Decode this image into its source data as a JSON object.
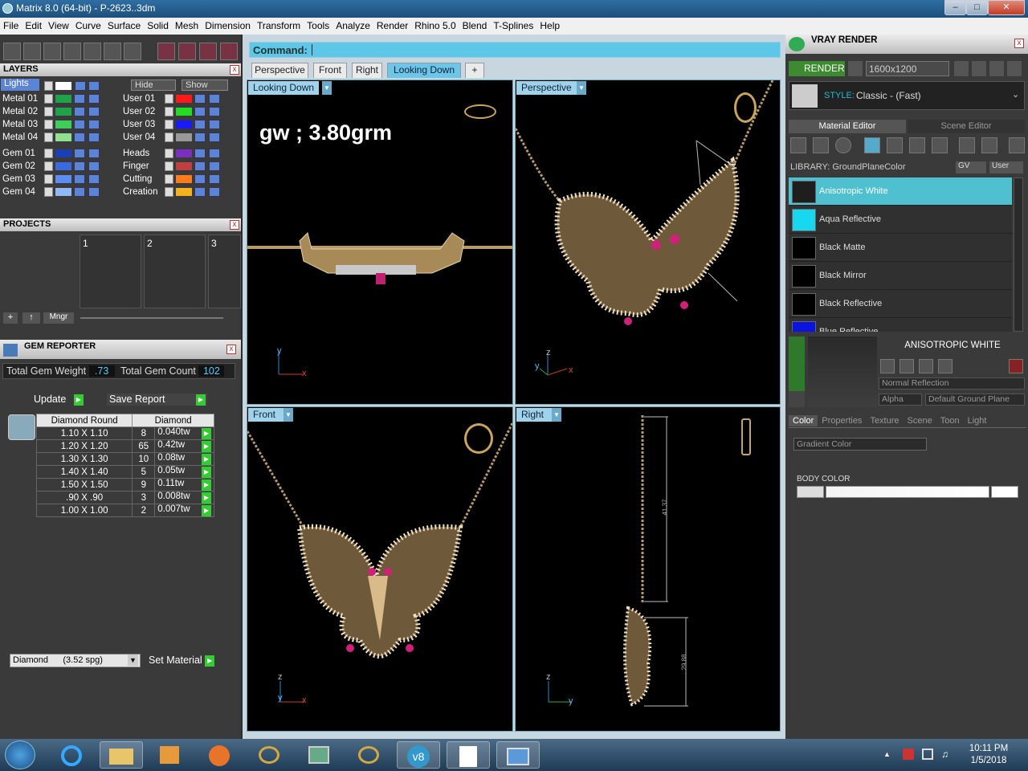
{
  "window": {
    "title": "Matrix 8.0 (64-bit) - P-2623..3dm"
  },
  "menu": [
    "File",
    "Edit",
    "View",
    "Curve",
    "Surface",
    "Solid",
    "Mesh",
    "Dimension",
    "Transform",
    "Tools",
    "Analyze",
    "Render",
    "Rhino 5.0",
    "Blend",
    "T-Splines",
    "Help"
  ],
  "layers": {
    "title": "LAYERS",
    "lights_label": "Lights",
    "hide_label": "Hide",
    "show_label": "Show",
    "left": [
      {
        "name": "Metal 01",
        "color": "#1fa34a"
      },
      {
        "name": "Metal 02",
        "color": "#1fa34a"
      },
      {
        "name": "Metal 03",
        "color": "#3ccf5a"
      },
      {
        "name": "Metal 04",
        "color": "#8fe08f"
      },
      {
        "name": "Gem 01",
        "color": "#1a3fb8"
      },
      {
        "name": "Gem 02",
        "color": "#3a6ae0"
      },
      {
        "name": "Gem 03",
        "color": "#5b8ef0"
      },
      {
        "name": "Gem 04",
        "color": "#8fb8f5"
      }
    ],
    "right": [
      {
        "name": "User 01",
        "color": "#ff1a1a"
      },
      {
        "name": "User 02",
        "color": "#22dd22"
      },
      {
        "name": "User 03",
        "color": "#1a1aff"
      },
      {
        "name": "User 04",
        "color": "#999999"
      },
      {
        "name": "Heads",
        "color": "#7a2fc0"
      },
      {
        "name": "Finger",
        "color": "#c04040"
      },
      {
        "name": "Cutting",
        "color": "#ff7a1a"
      },
      {
        "name": "Creation",
        "color": "#f5b21a"
      }
    ]
  },
  "projects": {
    "title": "PROJECTS",
    "slots": [
      "1",
      "2",
      "3"
    ],
    "mngr_label": "Mngr"
  },
  "gem_reporter": {
    "title": "GEM REPORTER",
    "weight_label": "Total Gem Weight",
    "weight_value": ".73",
    "count_label": "Total Gem Count",
    "count_value": "102",
    "update_label": "Update",
    "save_label": "Save Report",
    "col1": "Diamond Round",
    "col2": "Diamond",
    "rows": [
      {
        "size": "1.10 X 1.10",
        "count": "8",
        "tw": "0.040tw"
      },
      {
        "size": "1.20 X 1.20",
        "count": "65",
        "tw": "0.42tw"
      },
      {
        "size": "1.30 X 1.30",
        "count": "10",
        "tw": "0.08tw"
      },
      {
        "size": "1.40 X 1.40",
        "count": "5",
        "tw": "0.05tw"
      },
      {
        "size": "1.50 X 1.50",
        "count": "9",
        "tw": "0.11tw"
      },
      {
        "size": ".90 X .90",
        "count": "3",
        "tw": "0.008tw"
      },
      {
        "size": "1.00 X 1.00",
        "count": "2",
        "tw": "0.007tw"
      }
    ],
    "material_select": "Diamond      (3.52 spg)",
    "set_material_label": "Set Material"
  },
  "command": {
    "label": "Command:"
  },
  "view_tabs": [
    "Perspective",
    "Front",
    "Right",
    "Looking Down"
  ],
  "viewports": {
    "top_left": {
      "label": "Looking Down",
      "annotation": "gw ; 3.80grm",
      "axis1": "y",
      "axis2": "x"
    },
    "top_right": {
      "label": "Perspective",
      "axis1": "z",
      "axis2": "x",
      "axis3": "y"
    },
    "bottom_left": {
      "label": "Front",
      "axis1": "z",
      "axis2": "x",
      "axis3": "y"
    },
    "bottom_right": {
      "label": "Right",
      "axis1": "z",
      "axis2": "y",
      "dim1": "41.37",
      "dim2": "29.88"
    }
  },
  "vray": {
    "title": "VRAY RENDER",
    "render_label": "RENDER",
    "resolution": "1600x1200",
    "style_label": "STYLE:",
    "style_value": "Classic - (Fast)",
    "tab_material": "Material Editor",
    "tab_scene": "Scene Editor",
    "library_label": "LIBRARY: GroundPlaneColor",
    "gv_label": "GV",
    "user_label": "User",
    "materials": [
      {
        "name": "Anisotropic White",
        "color": "#1e1e1e"
      },
      {
        "name": "Aqua Reflective",
        "color": "#18d8f0"
      },
      {
        "name": "Black Matte",
        "color": "#000000"
      },
      {
        "name": "Black Mirror",
        "color": "#000000"
      },
      {
        "name": "Black Reflective",
        "color": "#000000"
      },
      {
        "name": "Blue Reflective",
        "color": "#0a14e0"
      }
    ],
    "selected_title": "ANISOTROPIC WHITE",
    "reflection_select": "Normal Reflection",
    "alpha_label": "Alpha",
    "ground_select": "Default Ground Plane",
    "subtabs": [
      "Color",
      "Properties",
      "Texture",
      "Scene",
      "Toon",
      "Light"
    ],
    "gradient_select": "Gradient Color",
    "body_color_label": "BODY COLOR"
  },
  "taskbar": {
    "time": "10:11 PM",
    "date": "1/5/2018"
  }
}
